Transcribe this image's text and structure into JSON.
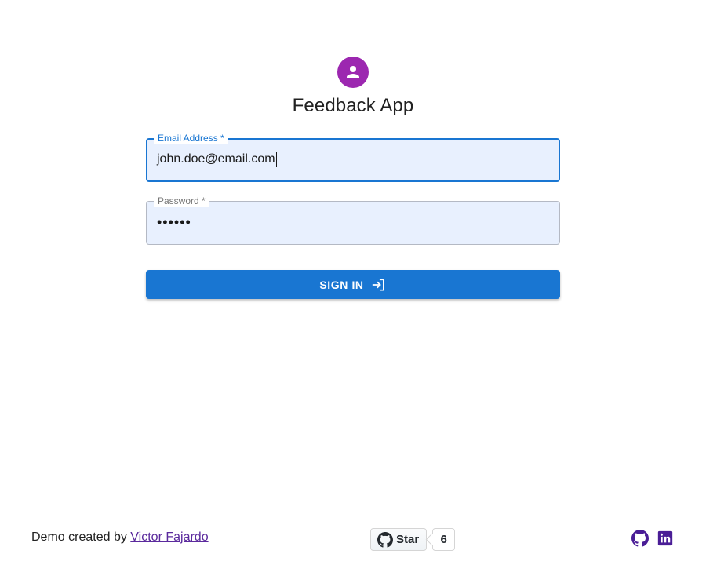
{
  "app": {
    "title": "Feedback App",
    "avatar_icon": "person-icon",
    "avatar_color": "#9c27b0"
  },
  "form": {
    "email": {
      "label": "Email Address *",
      "value": "john.doe@email.com"
    },
    "password": {
      "label": "Password *",
      "value": "••••••"
    },
    "submit_label": "SIGN IN",
    "submit_icon": "login-icon",
    "accent_color": "#1976d2"
  },
  "footer": {
    "credit_prefix": "Demo created by",
    "credit_link": "Victor Fajardo",
    "star_label": "Star",
    "star_count": "6",
    "github_icon": "github-icon",
    "linkedin_icon": "linkedin-icon",
    "social_color": "#4a1d96"
  }
}
